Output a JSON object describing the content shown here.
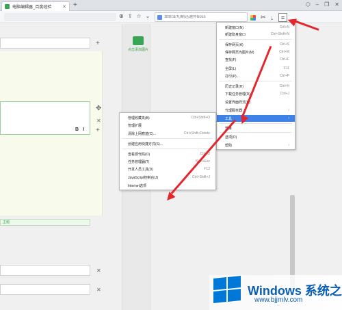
{
  "tab": {
    "title": "电脑编辑器_百度经验"
  },
  "toolbar": {
    "search_placeholder": "单职业切割迅速怀boss"
  },
  "side": {
    "add_image_label": "点击添加图片"
  },
  "editor": {
    "bold": "B",
    "italic": "I",
    "green_label": "主题"
  },
  "main_menu": {
    "items": [
      {
        "label": "新建窗口(N)",
        "shortcut": "Ctrl+N"
      },
      {
        "label": "新建隐身窗口",
        "shortcut": "Ctrl+Shift+N"
      },
      {
        "label": "保存网页(A)",
        "shortcut": "Ctrl+S"
      },
      {
        "label": "保存网页为图片(M)",
        "shortcut": "Ctrl+M"
      },
      {
        "label": "查找(F)",
        "shortcut": "Ctrl+F"
      },
      {
        "label": "全屏(L)",
        "shortcut": "F11"
      },
      {
        "label": "打印(P)...",
        "shortcut": "Ctrl+P"
      },
      {
        "label": "历史记录(H)",
        "shortcut": "Ctrl+H"
      },
      {
        "label": "下载任务管理(D)",
        "shortcut": "Ctrl+J"
      },
      {
        "label": "设置界面样式(U)",
        "shortcut": ""
      },
      {
        "label": "代理服务器",
        "shortcut": "›"
      },
      {
        "label": "工具",
        "shortcut": "›"
      },
      {
        "label": "登录",
        "shortcut": ""
      },
      {
        "label": "选项(O)",
        "shortcut": ""
      },
      {
        "label": "帮助",
        "shortcut": "›"
      }
    ]
  },
  "tools_menu": {
    "items": [
      {
        "label": "管理收藏夹(B)",
        "shortcut": "Ctrl+Shift+O"
      },
      {
        "label": "管理扩展",
        "shortcut": ""
      },
      {
        "label": "清除上网痕迹(C)...",
        "shortcut": "Ctrl+Shift+Delete"
      },
      {
        "label": "创建应用快捷方式(S)...",
        "shortcut": ""
      },
      {
        "label": "查看源代码(O)",
        "shortcut": "Ctrl+U"
      },
      {
        "label": "任务管理器(T)",
        "shortcut": "Shift+Esc"
      },
      {
        "label": "开发人员工具(D)",
        "shortcut": "F12"
      },
      {
        "label": "JavaScript控制台(J)",
        "shortcut": "Ctrl+Shift+J"
      },
      {
        "label": "Internet选项",
        "shortcut": ""
      }
    ]
  },
  "watermark": {
    "title": "Windows 系统之家",
    "url": "www.bjjmlv.com"
  },
  "colors": {
    "highlight": "#3d82e8",
    "arrow": "#e4262d",
    "brand_green": "#3aa655"
  }
}
